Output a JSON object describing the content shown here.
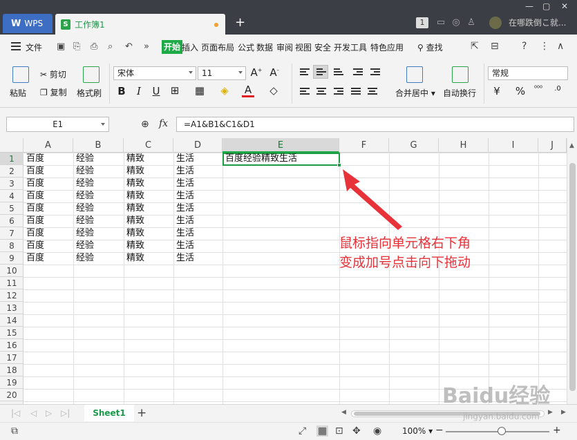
{
  "titlebar": {
    "app_tab": "WPS",
    "doc_tab": "工作簿1",
    "new_tab": "+",
    "badge": "1",
    "user_text": "在哪跌倒こ就...",
    "ctl_min": "—",
    "ctl_max": "▢"
  },
  "menu": {
    "file": "文件",
    "items": [
      "开始",
      "插入",
      "页面布局",
      "公式",
      "数据",
      "审阅",
      "视图",
      "安全",
      "开发工具",
      "特色应用"
    ],
    "search": "查找",
    "more": "»"
  },
  "ribbon": {
    "paste": "粘贴",
    "cut": "剪切",
    "copy": "复制",
    "format_painter": "格式刷",
    "font_name": "宋体",
    "font_size": "11",
    "bold": "B",
    "italic": "I",
    "underline": "U",
    "merge_center": "合并居中",
    "wrap_text": "自动换行",
    "number_format": "常规",
    "percent": "%"
  },
  "formula_bar": {
    "name_box": "E1",
    "fx": "fx",
    "formula": "=A1&B1&C1&D1"
  },
  "grid": {
    "columns": [
      "A",
      "B",
      "C",
      "D",
      "E",
      "F",
      "G",
      "H",
      "I",
      "J"
    ],
    "active_column": "E",
    "active_row": "1",
    "rows": [
      "1",
      "2",
      "3",
      "4",
      "5",
      "6",
      "7",
      "8",
      "9",
      "10",
      "11",
      "12",
      "13",
      "14",
      "15",
      "16",
      "17",
      "18",
      "19",
      "20"
    ],
    "data": [
      [
        "百度",
        "经验",
        "精致",
        "生活"
      ],
      [
        "百度",
        "经验",
        "精致",
        "生活"
      ],
      [
        "百度",
        "经验",
        "精致",
        "生活"
      ],
      [
        "百度",
        "经验",
        "精致",
        "生活"
      ],
      [
        "百度",
        "经验",
        "精致",
        "生活"
      ],
      [
        "百度",
        "经验",
        "精致",
        "生活"
      ],
      [
        "百度",
        "经验",
        "精致",
        "生活"
      ],
      [
        "百度",
        "经验",
        "精致",
        "生活"
      ],
      [
        "百度",
        "经验",
        "精致",
        "生活"
      ]
    ],
    "e1_value": "百度经验精致生活"
  },
  "annotation": {
    "line1": "鼠标指向单元格右下角",
    "line2": "变成加号点击向下拖动",
    "color": "#e8323a"
  },
  "sheets": {
    "tabs": [
      "Sheet1"
    ],
    "add": "+"
  },
  "statusbar": {
    "zoom": "100%"
  },
  "watermark": {
    "main": "Baidu经验",
    "sub": "jingyan.baidu.com"
  }
}
